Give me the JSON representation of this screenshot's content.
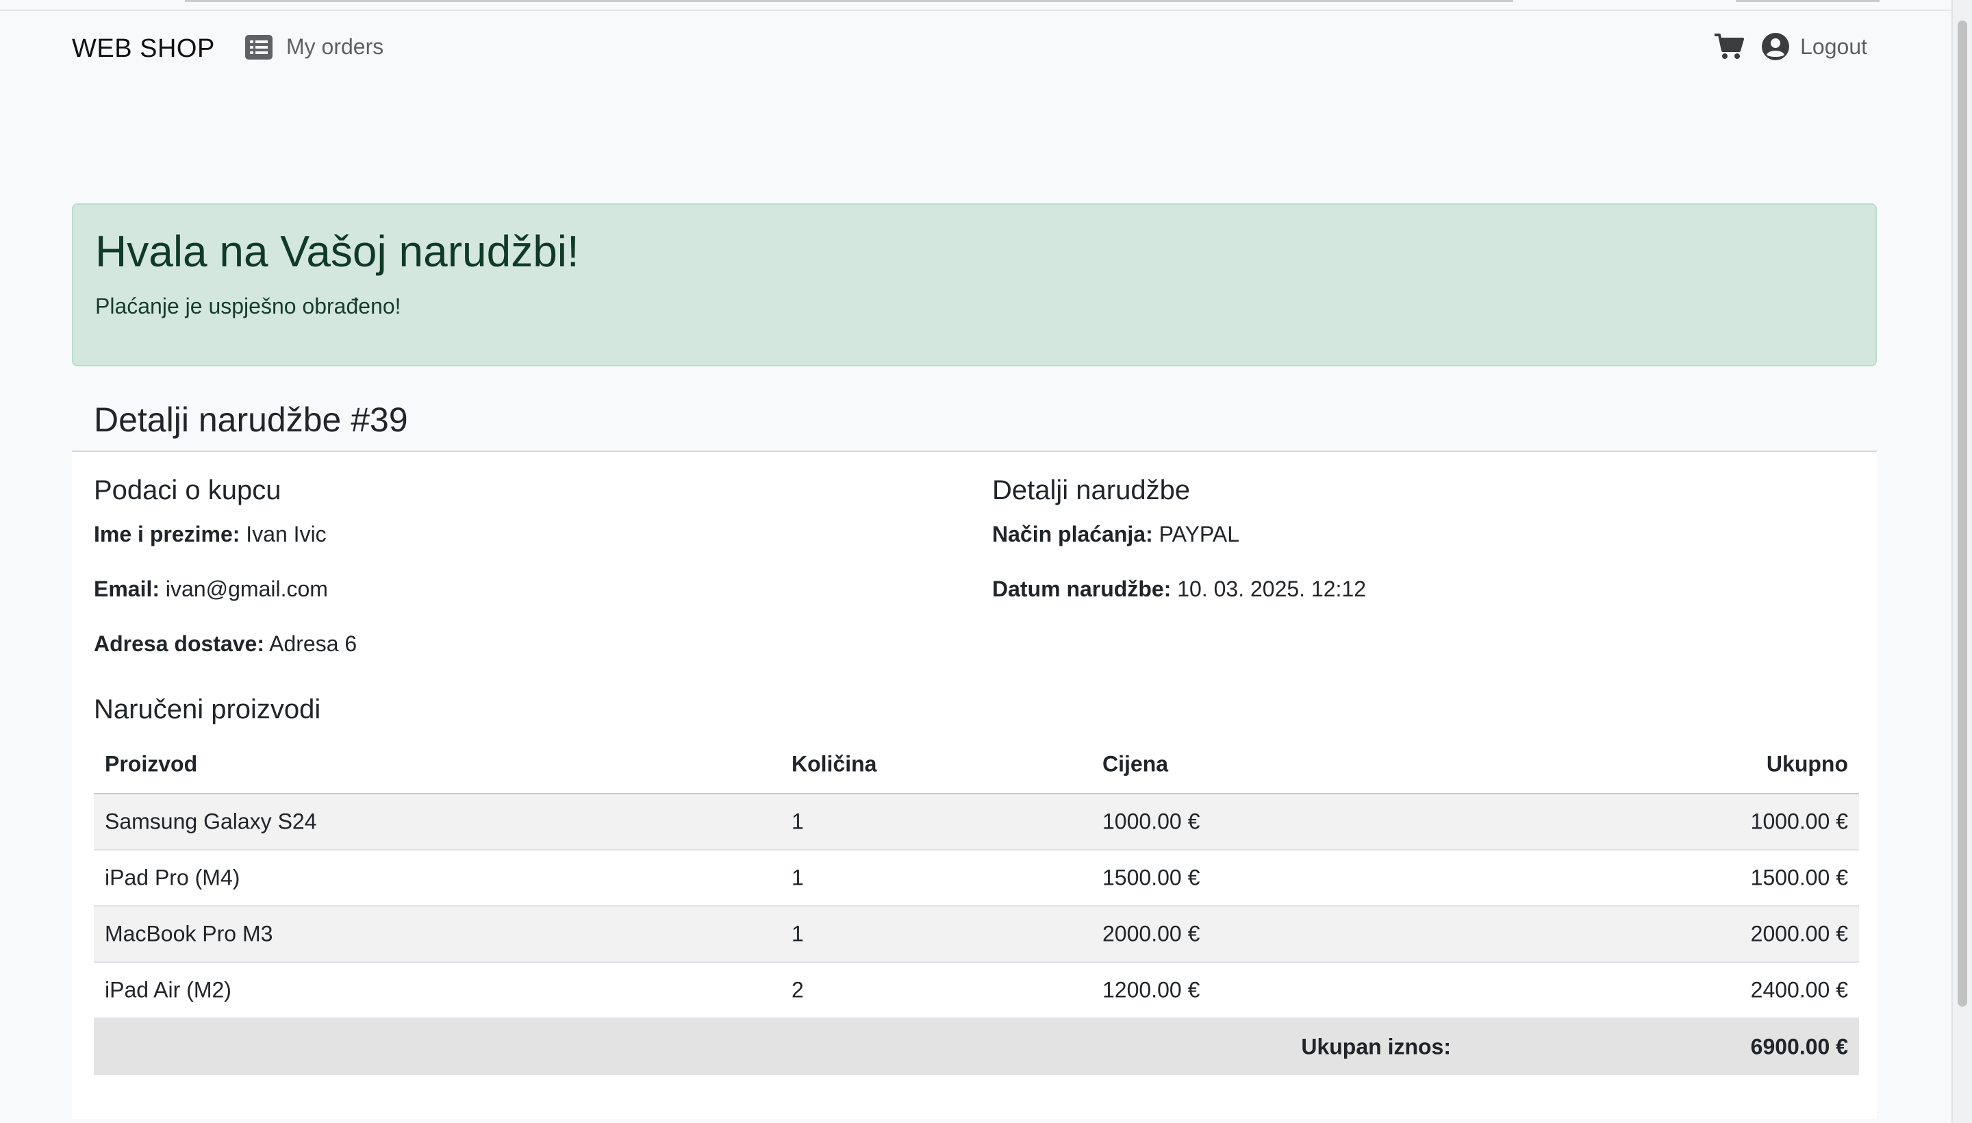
{
  "colors": {
    "page_background": "#f8f9fa",
    "alert_background": "#d4e7df",
    "alert_text": "#0f3a26",
    "card_background": "#ffffff"
  },
  "navbar": {
    "brand": "WEB SHOP",
    "my_orders_label": "My orders",
    "my_orders_icon": "list-icon",
    "cart_icon": "cart-icon",
    "user_icon": "user-circle-icon",
    "logout_label": "Logout"
  },
  "alert": {
    "title": "Hvala na Vašoj narudžbi!",
    "message": "Plaćanje je uspješno obrađeno!"
  },
  "order": {
    "header_title": "Detalji narudžbe #39",
    "customer": {
      "title": "Podaci o kupcu",
      "name_label": "Ime i prezime:",
      "name_value": "Ivan Ivic",
      "email_label": "Email:",
      "email_value": "ivan@gmail.com",
      "address_label": "Adresa dostave:",
      "address_value": "Adresa 6"
    },
    "details": {
      "title": "Detalji narudžbe",
      "payment_label": "Način plaćanja:",
      "payment_value": "PAYPAL",
      "date_label": "Datum narudžbe:",
      "date_value": "10. 03. 2025. 12:12"
    },
    "products": {
      "title": "Naručeni proizvodi",
      "columns": [
        "Proizvod",
        "Količina",
        "Cijena",
        "Ukupno"
      ],
      "rows": [
        {
          "name": "Samsung Galaxy S24",
          "qty": "1",
          "price": "1000.00 €",
          "total": "1000.00 €"
        },
        {
          "name": "iPad Pro (M4)",
          "qty": "1",
          "price": "1500.00 €",
          "total": "1500.00 €"
        },
        {
          "name": "MacBook Pro M3",
          "qty": "1",
          "price": "2000.00 €",
          "total": "2000.00 €"
        },
        {
          "name": "iPad Air (M2)",
          "qty": "2",
          "price": "1200.00 €",
          "total": "2400.00 €"
        }
      ],
      "total_label": "Ukupan iznos:",
      "total_value": "6900.00 €"
    }
  }
}
